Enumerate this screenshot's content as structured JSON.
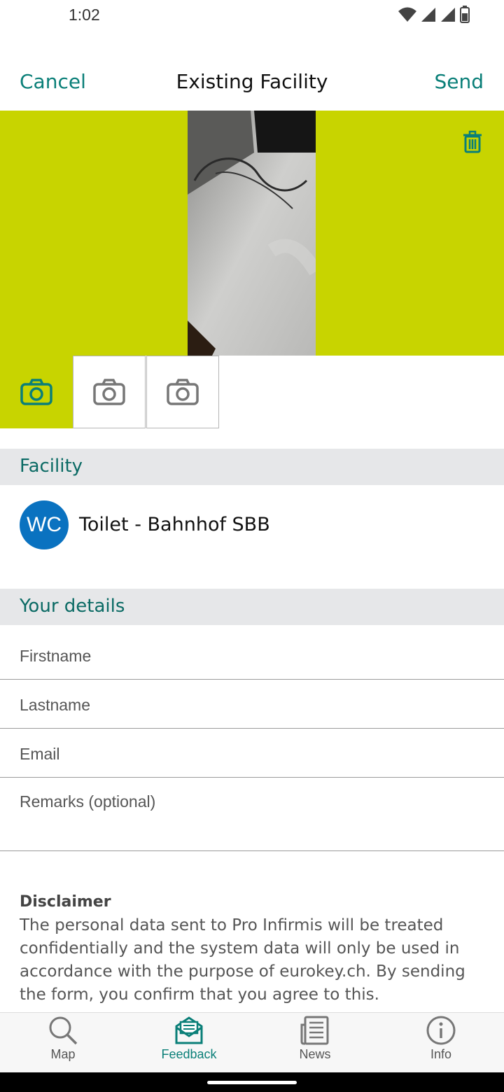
{
  "status": {
    "time": "1:02"
  },
  "header": {
    "cancel": "Cancel",
    "title": "Existing Facility",
    "send": "Send"
  },
  "sections": {
    "facility": "Facility",
    "details": "Your details"
  },
  "facility": {
    "badge": "WC",
    "name": "Toilet - Bahnhof SBB"
  },
  "form": {
    "firstname_placeholder": "Firstname",
    "lastname_placeholder": "Lastname",
    "email_placeholder": "Email",
    "remarks_placeholder": "Remarks (optional)"
  },
  "disclaimer": {
    "title": "Disclaimer",
    "text": "The personal data sent to Pro Infirmis will be treated confidentially and the system data will only be used in accordance with the purpose of eurokey.ch. By sending the form, you confirm that you agree to this."
  },
  "nav": [
    {
      "label": "Map",
      "icon": "search-icon"
    },
    {
      "label": "Feedback",
      "icon": "mail-icon"
    },
    {
      "label": "News",
      "icon": "newspaper-icon"
    },
    {
      "label": "Info",
      "icon": "info-icon"
    }
  ],
  "colors": {
    "accent": "#0a7f78",
    "lime": "#c8d400",
    "badge": "#0a72c0"
  }
}
